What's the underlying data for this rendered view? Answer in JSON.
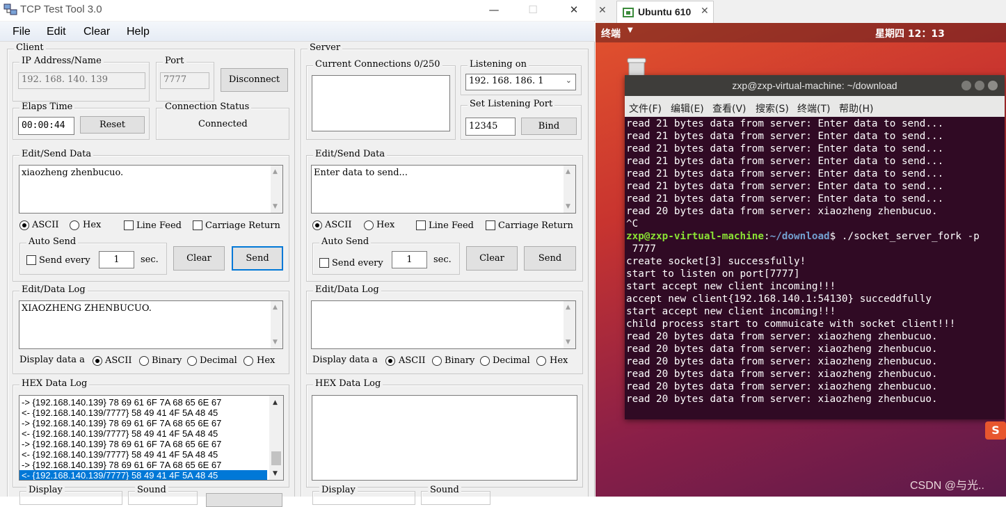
{
  "window": {
    "title": "TCP Test Tool 3.0",
    "min": "—",
    "max": "☐",
    "close": "✕"
  },
  "menu": [
    "File",
    "Edit",
    "Clear",
    "Help"
  ],
  "client": {
    "title": "Client",
    "ip_label": "IP Address/Name",
    "ip_value": "192. 168. 140. 139",
    "port_label": "Port",
    "port_value": "7777",
    "disconnect": "Disconnect",
    "elaps_label": "Elaps Time",
    "elaps_value": "00:00:44",
    "reset": "Reset",
    "status_label": "Connection Status",
    "status_value": "Connected",
    "send_label": "Edit/Send Data",
    "send_text": "xiaozheng zhenbucuo.",
    "ascii": "ASCII",
    "hex": "Hex",
    "line_feed": "Line Feed",
    "carriage_return": "Carriage Return",
    "auto_send": "Auto Send",
    "send_every": "Send every",
    "interval": "1",
    "sec": "sec.",
    "clear": "Clear",
    "send": "Send",
    "log_label": "Edit/Data Log",
    "log_text": "XIAOZHENG ZHENBUCUO.",
    "display_data": "Display data a",
    "d_ascii": "ASCII",
    "d_binary": "Binary",
    "d_decimal": "Decimal",
    "d_hex": "Hex",
    "hex_label": "HEX Data Log",
    "hex_lines": [
      "->  {192.168.140.139}  78 69 61 6F 7A 68 65 6E 67",
      "<-  {192.168.140.139/7777}  58 49 41 4F 5A 48 45",
      "->  {192.168.140.139}  78 69 61 6F 7A 68 65 6E 67",
      "<-  {192.168.140.139/7777}  58 49 41 4F 5A 48 45",
      "->  {192.168.140.139}  78 69 61 6F 7A 68 65 6E 67",
      "<-  {192.168.140.139/7777}  58 49 41 4F 5A 48 45",
      "->  {192.168.140.139}  78 69 61 6F 7A 68 65 6E 67",
      "<-  {192.168.140.139/7777}  58 49 41 4F 5A 48 45"
    ],
    "display": "Display",
    "sound": "Sound"
  },
  "server": {
    "title": "Server",
    "connections_label": "Current Connections 0/250",
    "listening_label": "Listening on",
    "listening_value": "192. 168. 186. 1",
    "set_port_label": "Set Listening Port",
    "port_value": "12345",
    "bind": "Bind",
    "send_label": "Edit/Send Data",
    "send_text": "Enter data to send...",
    "ascii": "ASCII",
    "hex": "Hex",
    "line_feed": "Line Feed",
    "carriage_return": "Carriage Return",
    "auto_send": "Auto Send",
    "send_every": "Send every",
    "interval": "1",
    "sec": "sec.",
    "clear": "Clear",
    "send": "Send",
    "log_label": "Edit/Data Log",
    "display_data": "Display data a",
    "d_ascii": "ASCII",
    "d_binary": "Binary",
    "d_decimal": "Decimal",
    "d_hex": "Hex",
    "hex_label": "HEX Data Log",
    "display": "Display",
    "sound": "Sound"
  },
  "vm": {
    "tab_title": "Ubuntu 610",
    "close": "✕",
    "topbar_app": "终端",
    "topbar_clock": "星期四 12：13"
  },
  "terminal": {
    "title": "zxp@zxp-virtual-machine: ~/download",
    "menu": [
      "文件(F)",
      "编辑(E)",
      "查看(V)",
      "搜索(S)",
      "终端(T)",
      "帮助(H)"
    ],
    "lines_before": [
      "read 21 bytes data from server: Enter data to send...",
      "read 21 bytes data from server: Enter data to send...",
      "read 21 bytes data from server: Enter data to send...",
      "read 21 bytes data from server: Enter data to send...",
      "read 21 bytes data from server: Enter data to send...",
      "read 21 bytes data from server: Enter data to send...",
      "read 21 bytes data from server: Enter data to send...",
      "read 20 bytes data from server: xiaozheng zhenbucuo.",
      "^C"
    ],
    "prompt_user": "zxp@zxp-virtual-machine",
    "prompt_sep": ":",
    "prompt_path": "~/download",
    "prompt_cmd": "$ ./socket_server_fork -p",
    "prompt_cont": " 7777",
    "lines_after": [
      "create socket[3] successfully!",
      "start to listen on port[7777]",
      "start accept new client incoming!!!",
      "accept new client{192.168.140.1:54130} succeddfully",
      "start accept new client incoming!!!",
      "child process start to commuicate with socket client!!!",
      "read 20 bytes data from server: xiaozheng zhenbucuo.",
      "read 20 bytes data from server: xiaozheng zhenbucuo.",
      "read 20 bytes data from server: xiaozheng zhenbucuo.",
      "read 20 bytes data from server: xiaozheng zhenbucuo.",
      "read 20 bytes data from server: xiaozheng zhenbucuo.",
      "read 20 bytes data from server: xiaozheng zhenbucuo."
    ]
  },
  "watermark": "CSDN @与光..",
  "colors": {
    "accent": "#0078d7",
    "terminal_bg": "#300a24",
    "prompt_user": "#8ae234",
    "prompt_path": "#729fcf"
  }
}
